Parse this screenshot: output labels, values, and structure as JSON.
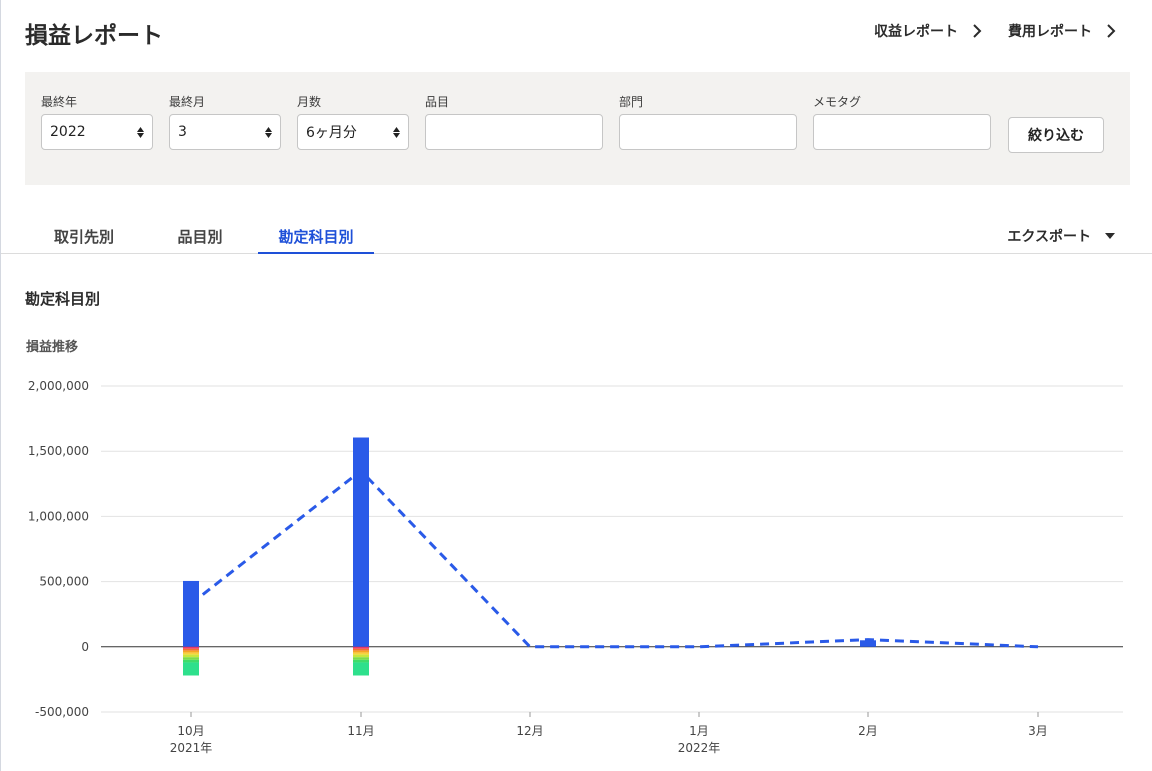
{
  "header": {
    "title": "損益レポート",
    "links": [
      "収益レポート",
      "費用レポート"
    ]
  },
  "filters": {
    "year": {
      "label": "最終年",
      "value": "2022"
    },
    "month": {
      "label": "最終月",
      "value": "3"
    },
    "months_count": {
      "label": "月数",
      "value": "6ヶ月分"
    },
    "item": {
      "label": "品目",
      "value": ""
    },
    "department": {
      "label": "部門",
      "value": ""
    },
    "memo_tag": {
      "label": "メモタグ",
      "value": ""
    },
    "submit_label": "絞り込む"
  },
  "tabs": [
    {
      "label": "取引先別",
      "active": false
    },
    {
      "label": "品目別",
      "active": false
    },
    {
      "label": "勘定科目別",
      "active": true
    }
  ],
  "export_label": "エクスポート",
  "section_title": "勘定科目別",
  "chart_title": "損益推移",
  "colors": {
    "accent": "#1e50d8",
    "bar_primary": "#2a5ae8"
  },
  "chart_data": {
    "type": "bar",
    "title": "損益推移",
    "categories": [
      "10月",
      "11月",
      "12月",
      "1月",
      "2月",
      "3月"
    ],
    "category_years": [
      "2021年",
      "",
      "",
      "2022年",
      "",
      ""
    ],
    "ylim": [
      -500000,
      2000000
    ],
    "yticks": [
      2000000,
      1500000,
      1000000,
      500000,
      0,
      -500000
    ],
    "ytick_labels": [
      "2,000,000",
      "1,500,000",
      "1,000,000",
      "500,000",
      "0",
      "-500,000"
    ],
    "grid": true,
    "revenue_bars": [
      505000,
      1605000,
      0,
      0,
      50000,
      0
    ],
    "expense_stacks": [
      [
        {
          "value": -15000,
          "color": "#e8386b"
        },
        {
          "value": -15000,
          "color": "#f27230"
        },
        {
          "value": -15000,
          "color": "#f5a623"
        },
        {
          "value": -15000,
          "color": "#f8d23c"
        },
        {
          "value": -20000,
          "color": "#c8e63c"
        },
        {
          "value": -20000,
          "color": "#7ddc4a"
        },
        {
          "value": -20000,
          "color": "#3fdc6a"
        },
        {
          "value": -100000,
          "color": "#2ee08c"
        }
      ],
      [
        {
          "value": -15000,
          "color": "#e8386b"
        },
        {
          "value": -15000,
          "color": "#f27230"
        },
        {
          "value": -15000,
          "color": "#f5a623"
        },
        {
          "value": -15000,
          "color": "#f8d23c"
        },
        {
          "value": -20000,
          "color": "#c8e63c"
        },
        {
          "value": -20000,
          "color": "#7ddc4a"
        },
        {
          "value": -20000,
          "color": "#3fdc6a"
        },
        {
          "value": -100000,
          "color": "#2ee08c"
        }
      ],
      [],
      [],
      [],
      []
    ],
    "profit_line": [
      330000,
      1350000,
      0,
      0,
      55000,
      0
    ]
  }
}
